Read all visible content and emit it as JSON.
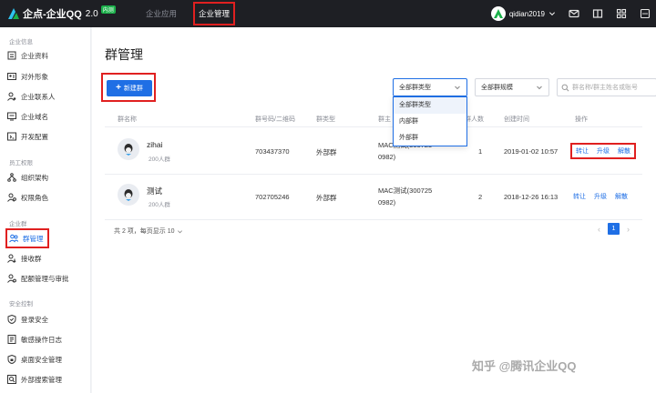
{
  "app": {
    "logo_text": "企点-企业QQ",
    "logo_version": "2.0",
    "logo_badge": "内测",
    "brand_color": "#1f6fe5"
  },
  "topnav": {
    "items": [
      {
        "label": "企业应用",
        "active": false
      },
      {
        "label": "企业管理",
        "active": true
      }
    ],
    "username": "qidian2019",
    "icons": [
      "chevron-down-icon",
      "mail-icon",
      "book-icon",
      "grid-icon",
      "more-icon"
    ]
  },
  "sidebar": {
    "sections": [
      {
        "title": "企业信息",
        "items": [
          {
            "label": "企业资料",
            "icon": "profile-card-icon"
          },
          {
            "label": "对外形象",
            "icon": "contact-card-icon"
          },
          {
            "label": "企业联系人",
            "icon": "contact-person-icon"
          },
          {
            "label": "企业域名",
            "icon": "domain-icon"
          },
          {
            "label": "开发配置",
            "icon": "dev-config-icon"
          }
        ]
      },
      {
        "title": "员工权限",
        "items": [
          {
            "label": "组织架构",
            "icon": "org-structure-icon"
          },
          {
            "label": "权限角色",
            "icon": "role-icon"
          }
        ]
      },
      {
        "title": "企业群",
        "items": [
          {
            "label": "群管理",
            "icon": "group-manage-icon",
            "active": true
          },
          {
            "label": "接收群",
            "icon": "receive-group-icon"
          },
          {
            "label": "配额管理与审批",
            "icon": "quota-icon"
          }
        ]
      },
      {
        "title": "安全控制",
        "items": [
          {
            "label": "登录安全",
            "icon": "login-security-icon"
          },
          {
            "label": "敏感操作日志",
            "icon": "log-icon"
          },
          {
            "label": "桌面安全管理",
            "icon": "desktop-security-icon"
          },
          {
            "label": "外部搜索管理",
            "icon": "external-search-icon"
          }
        ]
      }
    ]
  },
  "main": {
    "title": "群管理",
    "new_button": "新建群",
    "filters": {
      "group_type": "全部群类型",
      "group_size": "全部群规模",
      "search_placeholder": "群名称/群主姓名或账号"
    },
    "dropdown_options": [
      "全部群类型",
      "内部群",
      "外部群"
    ],
    "columns": [
      "群名称",
      "群号码/二维码",
      "群类型",
      "群主",
      "群人数",
      "创建时间",
      "操作"
    ],
    "rows": [
      {
        "name": "zihai",
        "count": "200人群",
        "number": "703437370",
        "type": "外部群",
        "owner_line1": "MAC测试(300725",
        "owner_line2": "0982)",
        "members": "1",
        "created": "2019-01-02 10:57",
        "actions": [
          "转让",
          "升级",
          "解散"
        ]
      },
      {
        "name": "测试",
        "count": "200人群",
        "number": "702705246",
        "type": "外部群",
        "owner_line1": "MAC测试(300725",
        "owner_line2": "0982)",
        "members": "2",
        "created": "2018-12-26 16:13",
        "actions": [
          "转让",
          "升级",
          "解散"
        ]
      }
    ],
    "footer": "共 2 项，每页显示 10",
    "pager": {
      "current": "1"
    }
  },
  "watermark": "知乎 @腾讯企业QQ"
}
